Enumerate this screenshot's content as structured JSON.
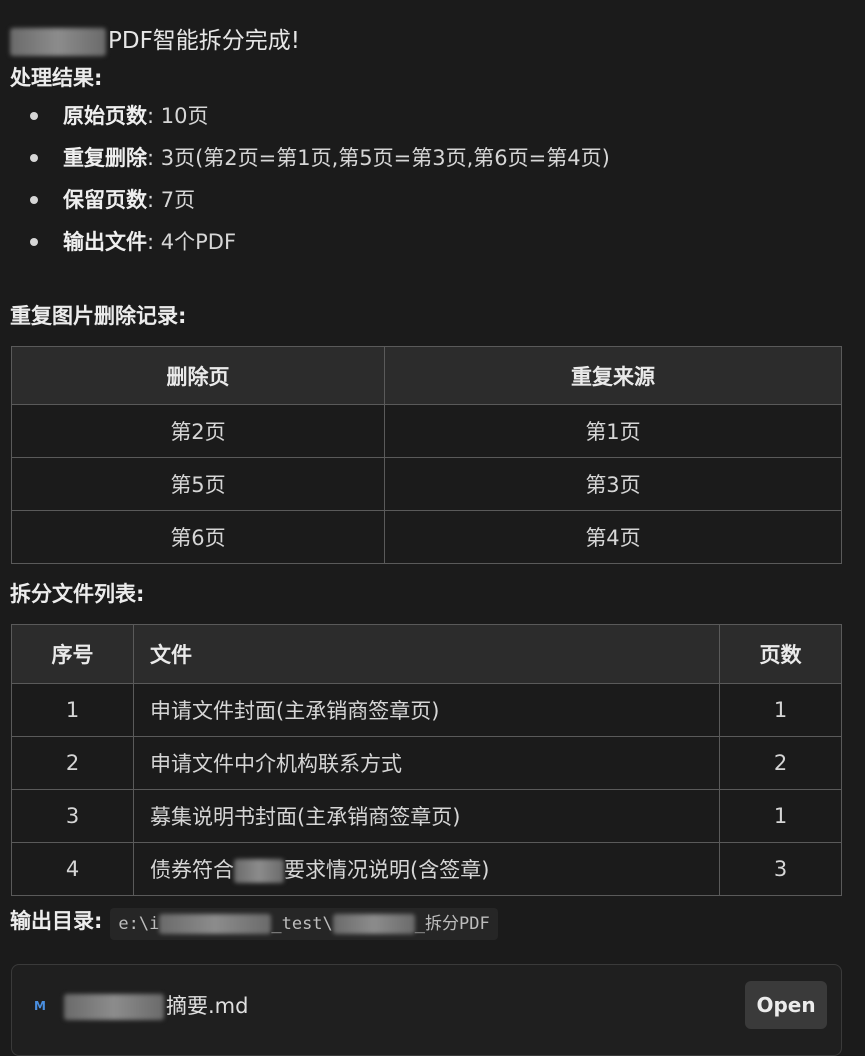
{
  "header": {
    "title_suffix": "PDF智能拆分完成!"
  },
  "results": {
    "heading": "处理结果:",
    "items": [
      {
        "key": "原始页数",
        "value": ": 10页"
      },
      {
        "key": "重复删除",
        "value": ": 3页(第2页=第1页,第5页=第3页,第6页=第4页)"
      },
      {
        "key": "保留页数",
        "value": ": 7页"
      },
      {
        "key": "输出文件",
        "value": ": 4个PDF"
      }
    ]
  },
  "duplicates": {
    "heading": "重复图片删除记录:",
    "headers": [
      "删除页",
      "重复来源"
    ],
    "rows": [
      [
        "第2页",
        "第1页"
      ],
      [
        "第5页",
        "第3页"
      ],
      [
        "第6页",
        "第4页"
      ]
    ]
  },
  "files": {
    "heading": "拆分文件列表:",
    "headers": [
      "序号",
      "文件",
      "页数"
    ],
    "rows": [
      {
        "no": "1",
        "name": "申请文件封面(主承销商签章页)",
        "pages": "1"
      },
      {
        "no": "2",
        "name": "申请文件中介机构联系方式",
        "pages": "2"
      },
      {
        "no": "3",
        "name": "募集说明书封面(主承销商签章页)",
        "pages": "1"
      },
      {
        "no": "4",
        "name_prefix": "债券符合",
        "name_suffix": "要求情况说明(含签章)",
        "pages": "3"
      }
    ]
  },
  "output": {
    "label": "输出目录:",
    "path_start": "e:\\i",
    "path_mid": "_test\\",
    "path_end": "_拆分PDF"
  },
  "attachment": {
    "icon_text": "M",
    "name_suffix": "摘要.md",
    "open_label": "Open"
  }
}
